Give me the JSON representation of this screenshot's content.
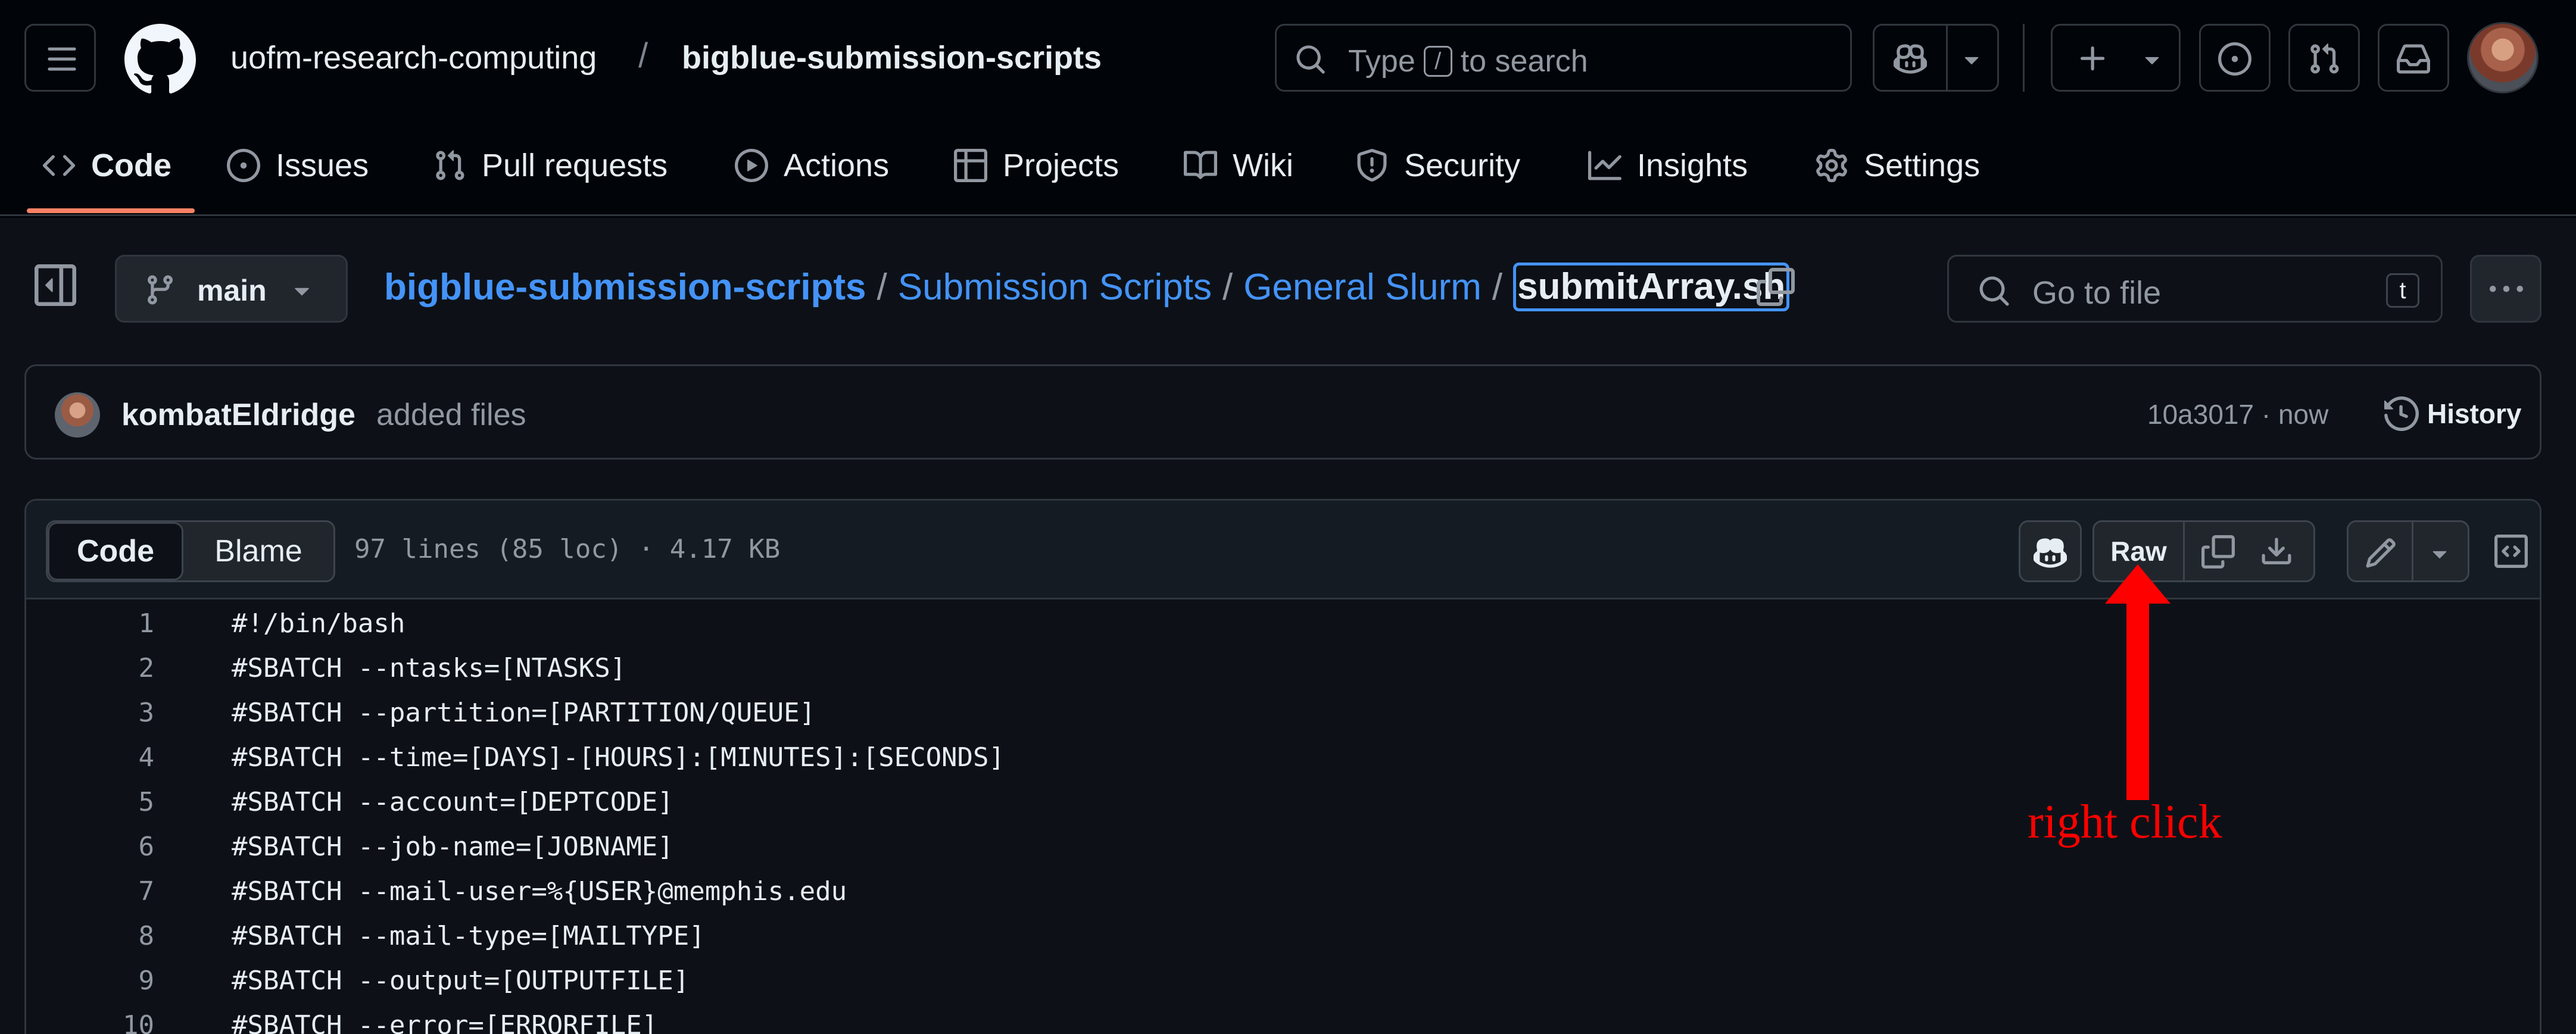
{
  "header": {
    "owner": "uofm-research-computing",
    "separator": "/",
    "repo": "bigblue-submission-scripts",
    "search_prefix": "Type",
    "search_key": "/",
    "search_suffix": "to search"
  },
  "repo_nav": {
    "tabs": [
      {
        "label": "Code",
        "icon": "code-icon",
        "active": true
      },
      {
        "label": "Issues",
        "icon": "issue-opened-icon"
      },
      {
        "label": "Pull requests",
        "icon": "git-pull-request-icon"
      },
      {
        "label": "Actions",
        "icon": "play-icon"
      },
      {
        "label": "Projects",
        "icon": "table-icon"
      },
      {
        "label": "Wiki",
        "icon": "book-icon"
      },
      {
        "label": "Security",
        "icon": "shield-icon"
      },
      {
        "label": "Insights",
        "icon": "graph-icon"
      },
      {
        "label": "Settings",
        "icon": "gear-icon"
      }
    ]
  },
  "file_header": {
    "branch": "main",
    "breadcrumb": {
      "repo": "bigblue-submission-scripts",
      "dir1": "Submission Scripts",
      "dir2": "General Slurm",
      "file": "submitArray.sh",
      "sep": "/"
    },
    "goto_placeholder": "Go to file",
    "goto_key": "t"
  },
  "commit": {
    "author": "kombatEldridge",
    "message": "added files",
    "meta": "10a3017 · now",
    "history_label": "History"
  },
  "file_view": {
    "code_tab": "Code",
    "blame_tab": "Blame",
    "info": "97 lines (85 loc) · 4.17 KB",
    "raw_label": "Raw",
    "lines": [
      {
        "n": "1",
        "text": "#!/bin/bash"
      },
      {
        "n": "2",
        "text": "#SBATCH --ntasks=[NTASKS]"
      },
      {
        "n": "3",
        "text": "#SBATCH --partition=[PARTITION/QUEUE]"
      },
      {
        "n": "4",
        "text": "#SBATCH --time=[DAYS]-[HOURS]:[MINUTES]:[SECONDS]"
      },
      {
        "n": "5",
        "text": "#SBATCH --account=[DEPTCODE]"
      },
      {
        "n": "6",
        "text": "#SBATCH --job-name=[JOBNAME]"
      },
      {
        "n": "7",
        "text": "#SBATCH --mail-user=%{USER}@memphis.edu"
      },
      {
        "n": "8",
        "text": "#SBATCH --mail-type=[MAILTYPE]"
      },
      {
        "n": "9",
        "text": "#SBATCH --output=[OUTPUTFILE]"
      },
      {
        "n": "10",
        "text": "#SBATCH --error=[ERRORFILE]"
      }
    ]
  },
  "annotation": {
    "text": "right click",
    "color": "#ff0000"
  },
  "colors": {
    "accent_link": "#4493f8",
    "nav_underline": "#f78166",
    "background": "#0d1117"
  }
}
